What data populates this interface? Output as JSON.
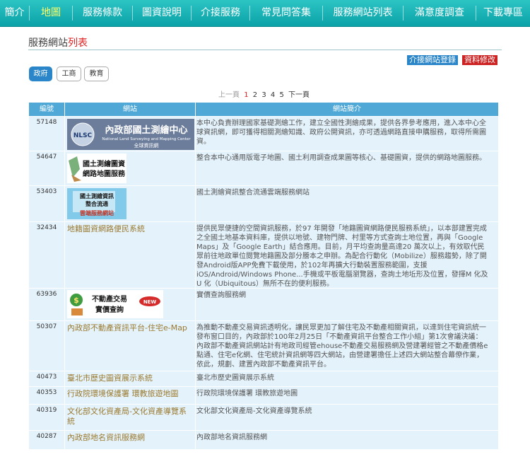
{
  "nav": [
    {
      "label": "簡介"
    },
    {
      "label": "地圖"
    },
    {
      "label": "服務條款"
    },
    {
      "label": "圖資說明"
    },
    {
      "label": "介接服務"
    },
    {
      "label": "常見問答集"
    },
    {
      "label": "服務網站列表"
    },
    {
      "label": "滿意度調查"
    },
    {
      "label": "下載專區"
    }
  ],
  "page": {
    "title": "服務網站",
    "title_highlight": "列表",
    "register_label": "介接網站登錄",
    "modify_label": "資料修改"
  },
  "categories": [
    {
      "label": "政府"
    },
    {
      "label": "工商"
    },
    {
      "label": "教育"
    }
  ],
  "pager": {
    "prev": "上一頁",
    "pages": [
      "1",
      "2",
      "3",
      "4",
      "5"
    ],
    "current": "1",
    "next": "下一頁"
  },
  "table": {
    "headers": {
      "id": "編號",
      "site": "網站",
      "desc": "網站簡介"
    },
    "rows": [
      {
        "id": "57148",
        "logo": "內政部國土測繪中心 National Land Surveying and Mapping Center 全球資訊網",
        "desc": "本中心負責辦理國家基礎測繪工作，建立全國性測繪成果，提供各界參考應用，進入本中心全球資訊網，即可獲得相關測繪知識、政府公開資訊，亦可透過網路直接申購服務，取得所需圖資。"
      },
      {
        "id": "54647",
        "logo": "國土測繪圖資網路地圖服務",
        "desc": "整合本中心通用版電子地圖、國土利用調查成果圖等核心、基礎圖資，提供的網路地圖服務。"
      },
      {
        "id": "53403",
        "logo": "國土測繪資訊整合流通 雲端服務網站",
        "desc": "國土測繪資訊整合流通雲端服務網站"
      },
      {
        "id": "32434",
        "link": "地籍圖資網路便民系統",
        "desc": "提供民眾便捷的空間資訊服務，於97 年開發「地籍圖資網路便民服務系統」，以本部建置完成之全國土地基本資料庫，提供以地號、建物門牌、村里等方式查詢土地位置，再與「Google Maps」及「Google Earth」結合應用。目前，月平均查詢量高達20 萬次以上，有效取代民眾前往地政單位閱覽地籍圖及部分謄本之申辦。為配合行動化（Mobilize）服務趨勢，除了開發Android版APP免費下載使用，於102年再擴大行動裝置服務範圍，支援iOS/Android/Windows Phone...手機或平板電腦瀏覽器，查詢土地坵形及位置，發揮M 化及U 化（Ubiquitous）無所不在的便利服務。"
      },
      {
        "id": "63936",
        "logo": "不動產交易實價查詢 NEW",
        "desc": "實價查詢服務網"
      },
      {
        "id": "50307",
        "link": "內政部不動產資訊平台-住宅e-Map",
        "desc": "為推動不動產交易資訊透明化，讓民眾更加了解住宅及不動產相關資訊，以達到住宅資訊統一發布窗口目的，內政部於100年2月25日「不動產資訊平台整合工作小組」第1次會議決議：內政部不動產資訊網站計有地政司經管ehouse不動產交易服務網及營建署經管之不動產價格e點通、住宅e化網、住宅統計資訊網等四大網站，由營建署擔任上述四大網站整合幕僚作業，依此，規劃、建置內政部不動產資訊平台。"
      },
      {
        "id": "40473",
        "link": "臺北市歷史圖資展示系統",
        "desc": "臺北市歷史圖資展示系統"
      },
      {
        "id": "40353",
        "link": "行政院環境保護署 環教旅遊地圖",
        "desc": "行政院環境保護署 環教旅遊地圖"
      },
      {
        "id": "40319",
        "link": "文化部文化資產局-文化資產導覽系統",
        "desc": "文化部文化資產局-文化資產導覽系統"
      },
      {
        "id": "40287",
        "link": "內政部地名資訊服務網",
        "desc": "內政部地名資訊服務網"
      }
    ]
  },
  "colors": {
    "nav_bg": "#18b3b8",
    "header_bg": "#4fa8d6",
    "row_bg": "#e4f2fb",
    "title_highlight": "#e02020",
    "link": "#9a7a30"
  }
}
